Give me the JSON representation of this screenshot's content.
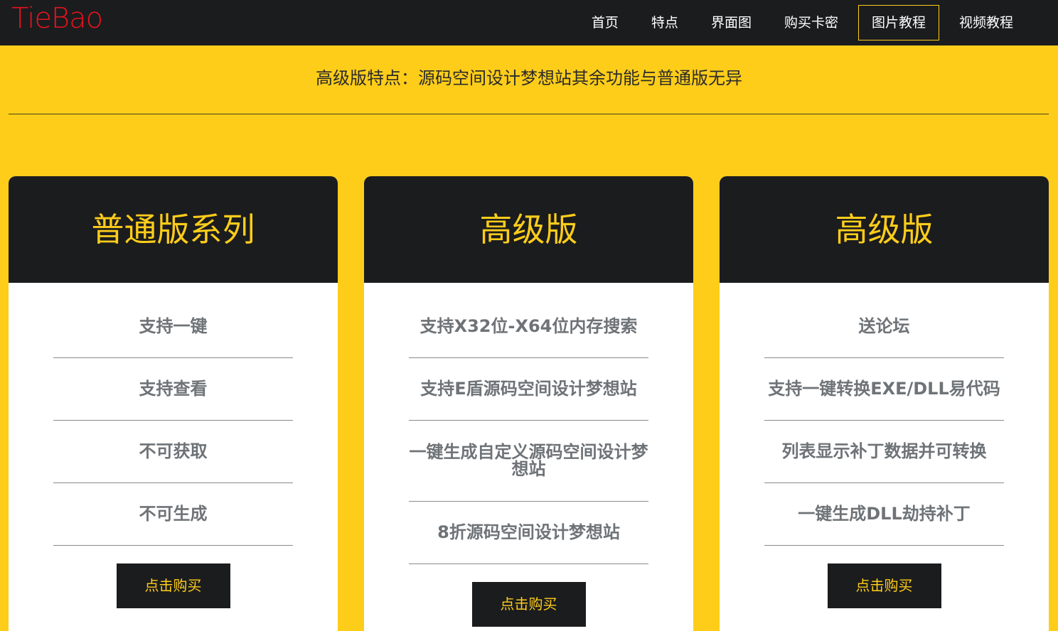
{
  "brand": {
    "logo_text": "TieBao",
    "logo_color": "#e3141d"
  },
  "nav": {
    "items": [
      {
        "label": "首页"
      },
      {
        "label": "特点"
      },
      {
        "label": "界面图"
      },
      {
        "label": "购买卡密"
      },
      {
        "label": "图片教程",
        "active": true
      },
      {
        "label": "视频教程"
      }
    ]
  },
  "feature": {
    "text": "高级版特点：源码空间设计梦想站其余功能与普通版无异"
  },
  "cards": [
    {
      "title": "普通版系列",
      "items": [
        "支持一键",
        "支持查看",
        "不可获取",
        "不可生成"
      ],
      "button": "点击购买"
    },
    {
      "title": "高级版",
      "items": [
        "支持X32位-X64位内存搜索",
        "支持E盾源码空间设计梦想站",
        "一键生成自定义源码空间设计梦想站",
        "8折源码空间设计梦想站"
      ],
      "button": "点击购买"
    },
    {
      "title": "高级版",
      "items": [
        "送论坛",
        "支持一键转换EXE/DLL易代码",
        "列表显示补丁数据并可转换",
        "一键生成DLL劫持补丁"
      ],
      "button": "点击购买"
    }
  ],
  "colors": {
    "background": "#fecd1a",
    "dark": "#1b1c1e",
    "accent": "#fecd1a",
    "item_text": "#6e7377"
  }
}
